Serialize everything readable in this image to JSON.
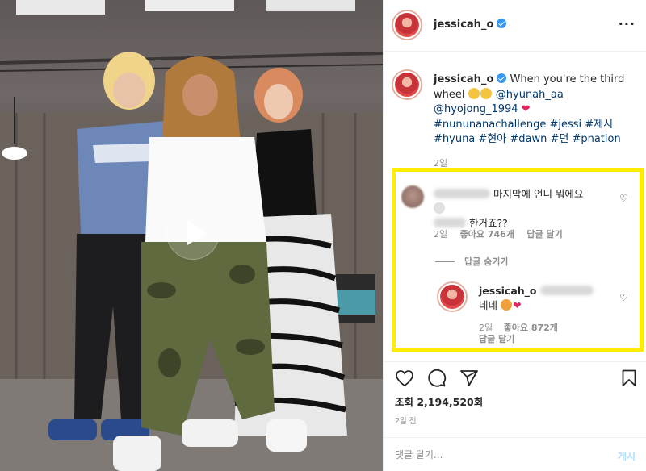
{
  "post": {
    "username": "jessicah_o",
    "more_icon": "more-horizontal-icon",
    "verified_icon": "verified-badge-icon"
  },
  "caption": {
    "username": "jessicah_o",
    "line1": "When you're the third",
    "line2a": "wheel",
    "mention1": "@hyunah_aa",
    "mention2": "@hyojong_1994",
    "hashtags_line1": "#nununanachallenge #jessi #제시",
    "hashtags_line2": "#hyuna #현아 #dawn #던 #pnation",
    "time": "2일"
  },
  "comment": {
    "text_part1": "마지막에 언니 뭐에요",
    "text_part2": "한거죠??",
    "time": "2일",
    "likes": "좋아요 746개",
    "reply": "답글 달기",
    "hide_replies": "답글 숨기기"
  },
  "reply": {
    "username": "jessicah_o",
    "text": "네네",
    "time": "2일",
    "likes": "좋아요 872개",
    "reply": "답글 달기"
  },
  "stats": {
    "views": "조회 2,194,520회",
    "date": "2일 전"
  },
  "comment_input": {
    "placeholder": "댓글 달기...",
    "post_label": "게시"
  },
  "icons": {
    "like": "heart-icon",
    "comment": "comment-icon",
    "share": "share-icon",
    "save": "bookmark-icon",
    "play": "play-icon"
  },
  "colors": {
    "highlight": "#ffec00",
    "link": "#00376b",
    "verified": "#3897f0",
    "muted": "#8e8e8e"
  }
}
